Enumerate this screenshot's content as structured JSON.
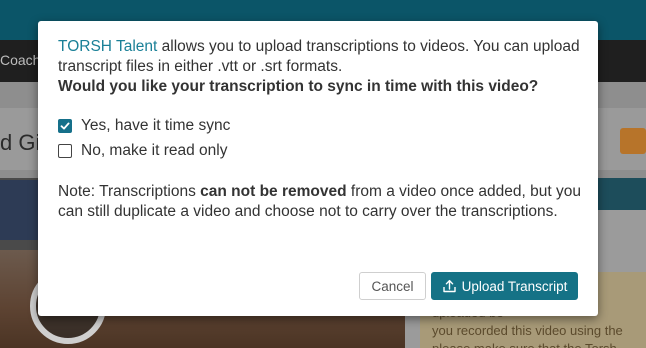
{
  "background": {
    "nav_fragment": "Coach",
    "title_fragment": "d Gi",
    "side_note_lines": [
      "uploaded be",
      "you recorded this video using the",
      "please make sure that the Torsh"
    ]
  },
  "modal": {
    "brand_name": "TORSH Talent",
    "intro_text": " allows you to upload transcriptions to videos. You can upload transcript files in either .vtt or .srt formats.",
    "question": "Would you like your transcription to sync in time with this video?",
    "options": [
      {
        "label": "Yes, have it time sync",
        "checked": true
      },
      {
        "label": "No, make it read only",
        "checked": false
      }
    ],
    "note_prefix": "Note: Transcriptions ",
    "note_emphasis": "can not be removed",
    "note_suffix": " from a video once added, but you can still duplicate a video and choose not to carry over the transcriptions.",
    "cancel_label": "Cancel",
    "upload_label": "Upload Transcript",
    "upload_icon": "upload-icon"
  },
  "colors": {
    "accent": "#157286",
    "link": "#1a8097"
  }
}
